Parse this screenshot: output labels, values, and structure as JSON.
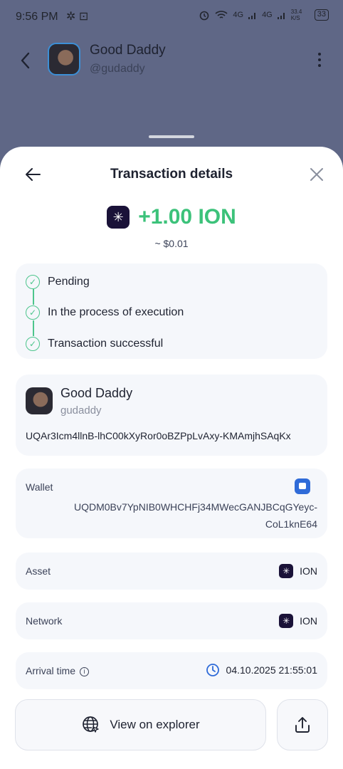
{
  "status_bar": {
    "time": "9:56 PM",
    "left_icons": "✲ ⊡",
    "network1": "4G",
    "network2": "4G",
    "speed": "33.4 K/S",
    "battery": "33"
  },
  "chat": {
    "name": "Good Daddy",
    "handle": "@gudaddy"
  },
  "sheet": {
    "title": "Transaction details",
    "amount": "+1.00 ION",
    "fiat": "~ $0.01",
    "steps": [
      {
        "label": "Pending"
      },
      {
        "label": "In the process of execution"
      },
      {
        "label": "Transaction successful"
      }
    ],
    "sender": {
      "name": "Good Daddy",
      "handle": "gudaddy",
      "address": "UQAr3Icm4llnB-lhC00kXyRor0oBZPpLvAxy-KMAmjhSAqKx"
    },
    "wallet": {
      "label": "Wallet",
      "address_line1": "UQDM0Bv7YpNIB0WHCHFj34MWecGANJBCqGYeyc-",
      "address_line2": "CoL1knE64"
    },
    "asset": {
      "label": "Asset",
      "value": "ION"
    },
    "network": {
      "label": "Network",
      "value": "ION"
    },
    "arrival": {
      "label": "Arrival time",
      "value": "04.10.2025 21:55:01"
    },
    "explorer_label": "View on explorer"
  },
  "colors": {
    "accent_green": "#3cc27a",
    "coin_bg": "#1a1238",
    "wallet_blue": "#2f6bd8",
    "overlay": "#5f6786"
  }
}
